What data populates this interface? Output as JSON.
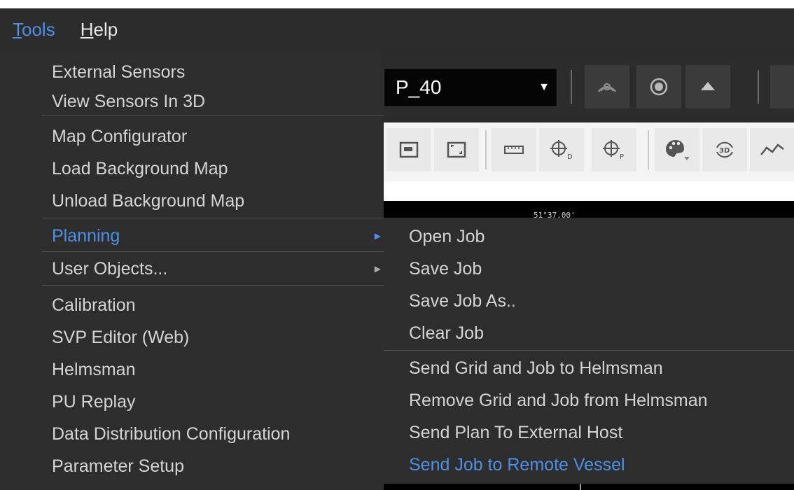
{
  "menubar": {
    "items": [
      {
        "label": "Tools",
        "mnemonic": "T",
        "rest": "ools",
        "active": true
      },
      {
        "label": "Help",
        "mnemonic": "H",
        "rest": "elp",
        "active": false
      }
    ]
  },
  "background": {
    "dropdown_value": "P_40",
    "coordinate_label": "51°37.00'"
  },
  "menu": {
    "items": [
      {
        "label": "External Sensors"
      },
      {
        "label": "View Sensors In 3D"
      },
      {
        "label": "Map Configurator"
      },
      {
        "label": "Load Background Map"
      },
      {
        "label": "Unload Background Map"
      },
      {
        "label": "Planning",
        "submenu": true,
        "highlighted": true
      },
      {
        "label": "User Objects...",
        "submenu": true
      },
      {
        "label": "Calibration"
      },
      {
        "label": "SVP Editor (Web)"
      },
      {
        "label": "Helmsman"
      },
      {
        "label": "PU Replay"
      },
      {
        "label": "Data Distribution Configuration"
      },
      {
        "label": "Parameter Setup"
      }
    ]
  },
  "submenu": {
    "items": [
      {
        "label": "Open Job"
      },
      {
        "label": "Save Job"
      },
      {
        "label": "Save Job As.."
      },
      {
        "label": "Clear Job"
      },
      {
        "label": "Send Grid and Job to Helmsman"
      },
      {
        "label": "Remove Grid and Job from Helmsman"
      },
      {
        "label": "Send Plan To External Host"
      },
      {
        "label": "Send Job to Remote Vessel",
        "highlighted": true
      }
    ]
  },
  "colors": {
    "accent": "#4b8fe6",
    "menu_bg": "#2d2d2d",
    "text": "#d4d4d4"
  },
  "icons": {
    "toolbar_dark": [
      "sonar-icon",
      "record-icon",
      "eject-icon"
    ],
    "toolbar_light": [
      "window-icon",
      "fit-icon",
      "ruler-icon",
      "target-d-icon",
      "target-p-icon",
      "palette-icon",
      "rotate-3d-icon",
      "line-chart-icon"
    ]
  }
}
